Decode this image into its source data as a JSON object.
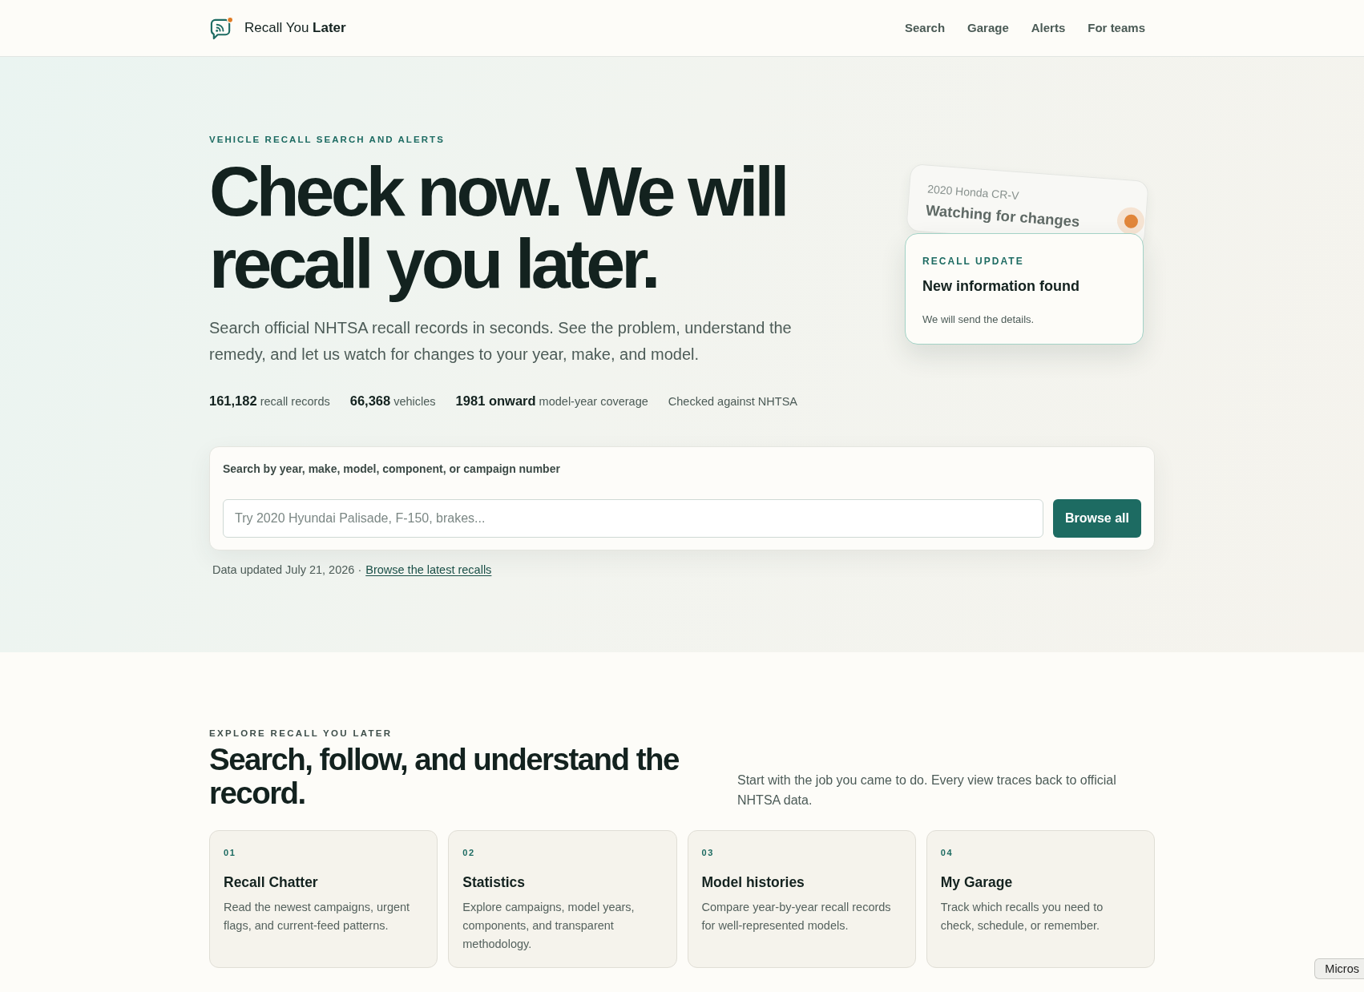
{
  "header": {
    "brand": "Recall You **Later**",
    "nav": [
      "Search",
      "Garage",
      "Alerts",
      "For teams"
    ]
  },
  "hero": {
    "eyebrow": "VEHICLE RECALL SEARCH AND ALERTS",
    "title": "Check now. We will recall you later.",
    "lead": "Search official NHTSA recall records in seconds. See the problem, understand the remedy, and let us watch for changes to your year, make, and model.",
    "stats": [
      {
        "figure": "161,182",
        "caption": "recall records"
      },
      {
        "figure": "66,368",
        "caption": "vehicles"
      },
      {
        "figure": "1981 onward",
        "caption": "model-year coverage"
      }
    ],
    "note": "Checked against NHTSA",
    "search": {
      "label": "Search by year, make, model, component, or campaign number",
      "placeholder": "Try 2020 Hyundai Palisade, F-150, brakes...",
      "button": "Browse all"
    },
    "updated": "Data updated July 21, 2026 ·",
    "updated_link": "Browse the latest recalls"
  },
  "preview": {
    "watch_card": {
      "vehicle": "2020 Honda CR-V",
      "status": "Watching for changes"
    },
    "update_card": {
      "eyebrow": "RECALL UPDATE",
      "title": "New information found",
      "body": "We will send the details."
    }
  },
  "explore": {
    "eyebrow": "EXPLORE RECALL YOU LATER",
    "title": "Search, follow, and understand the record.",
    "intro": "Start with the job you came to do. Every view traces back to official NHTSA data.",
    "cards": [
      {
        "number": "01",
        "title": "Recall Chatter",
        "body": "Read the newest campaigns, urgent flags, and current-feed patterns."
      },
      {
        "number": "02",
        "title": "Statistics",
        "body": "Explore campaigns, model years, components, and transparent methodology."
      },
      {
        "number": "03",
        "title": "Model histories",
        "body": "Compare year-by-year recall records for well-represented models."
      },
      {
        "number": "04",
        "title": "My Garage",
        "body": "Track which recalls you need to check, schedule, or remember."
      }
    ]
  },
  "tooltip": "Micros"
}
